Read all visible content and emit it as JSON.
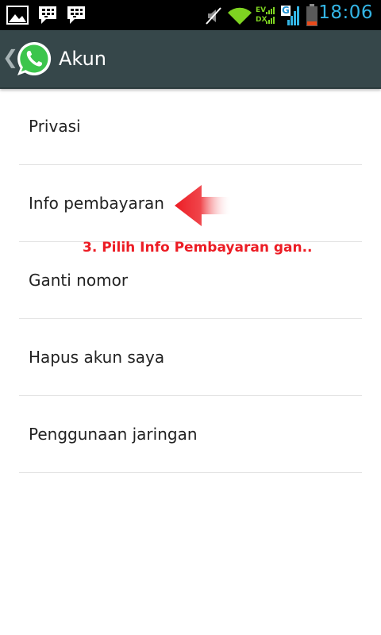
{
  "status_bar": {
    "icons": [
      "gallery-icon",
      "bbm-icon",
      "bbm-icon",
      "mute-icon",
      "wifi-icon",
      "ev-dx-signal-icon",
      "g-signal-icon",
      "battery-low-icon"
    ],
    "network_labels": {
      "ev": "EV",
      "dx": "DX",
      "g": "G"
    },
    "time": "18:06",
    "colors": {
      "clock": "#33b5e5",
      "wifi": "#7ed321",
      "battery": "#e84b1c"
    }
  },
  "action_bar": {
    "back_icon": "chevron-left-icon",
    "app_icon": "whatsapp-logo",
    "title": "Akun",
    "color": "#36474a"
  },
  "menu": {
    "items": [
      {
        "label": "Privasi"
      },
      {
        "label": "Info pembayaran"
      },
      {
        "label": "Ganti nomor"
      },
      {
        "label": "Hapus akun saya"
      },
      {
        "label": "Penggunaan jaringan"
      }
    ]
  },
  "annotation": {
    "arrow_icon": "red-arrow-left-icon",
    "text": "3. Pilih Info Pembayaran gan..",
    "color": "#ec1c24"
  }
}
